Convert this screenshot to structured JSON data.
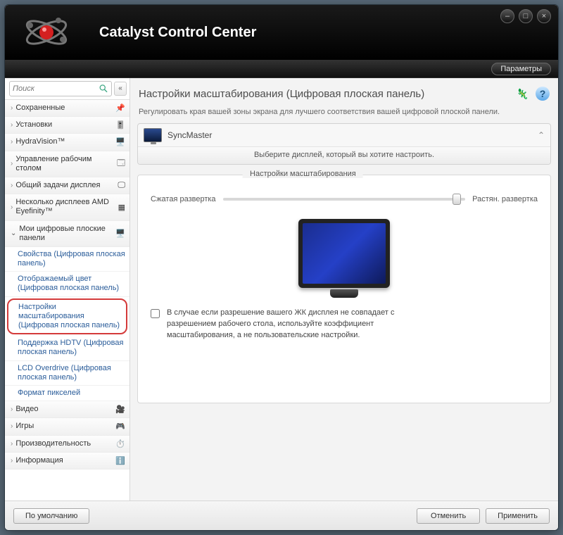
{
  "app": {
    "title": "Catalyst Control Center"
  },
  "window_controls": {
    "minimize": "–",
    "maximize": "□",
    "close": "×"
  },
  "params_button": "Параметры",
  "search": {
    "placeholder": "Поиск"
  },
  "sidebar": {
    "items": [
      {
        "label": "Сохраненные"
      },
      {
        "label": "Установки"
      },
      {
        "label": "HydraVision™"
      },
      {
        "label": "Управление рабочим столом"
      },
      {
        "label": "Общий задачи дисплея"
      },
      {
        "label": "Несколько дисплеев AMD Eyefinity™"
      },
      {
        "label": "Мои цифровые плоские панели"
      },
      {
        "label": "Видео"
      },
      {
        "label": "Игры"
      },
      {
        "label": "Производительность"
      },
      {
        "label": "Информация"
      }
    ],
    "sub": [
      {
        "label": "Свойства (Цифровая плоская панель)"
      },
      {
        "label": "Отображаемый цвет (Цифровая плоская панель)"
      },
      {
        "label": "Настройки масштабирования (Цифровая плоская панель)"
      },
      {
        "label": "Поддержка HDTV (Цифровая плоская панель)"
      },
      {
        "label": "LCD Overdrive (Цифровая плоская панель)"
      },
      {
        "label": "Формат пикселей"
      }
    ]
  },
  "page": {
    "title": "Настройки масштабирования (Цифровая плоская панель)",
    "description": "Регулировать края вашей зоны экрана для лучшего соответствия вашей цифровой плоской панели.",
    "help_glyph": "?"
  },
  "display_selector": {
    "name": "SyncMaster",
    "hint": "Выберите дисплей, который вы хотите настроить."
  },
  "scaling_group": {
    "title": "Настройки масштабирования",
    "min_label": "Сжатая развертка",
    "max_label": "Растян. развертка",
    "checkbox_text": "В случае если разрешение вашего ЖК дисплея не совпадает с разрешением рабочего стола, используйте коэффициент масштабирования, а не пользовательские настройки."
  },
  "footer": {
    "defaults": "По умолчанию",
    "cancel": "Отменить",
    "apply": "Применить"
  }
}
